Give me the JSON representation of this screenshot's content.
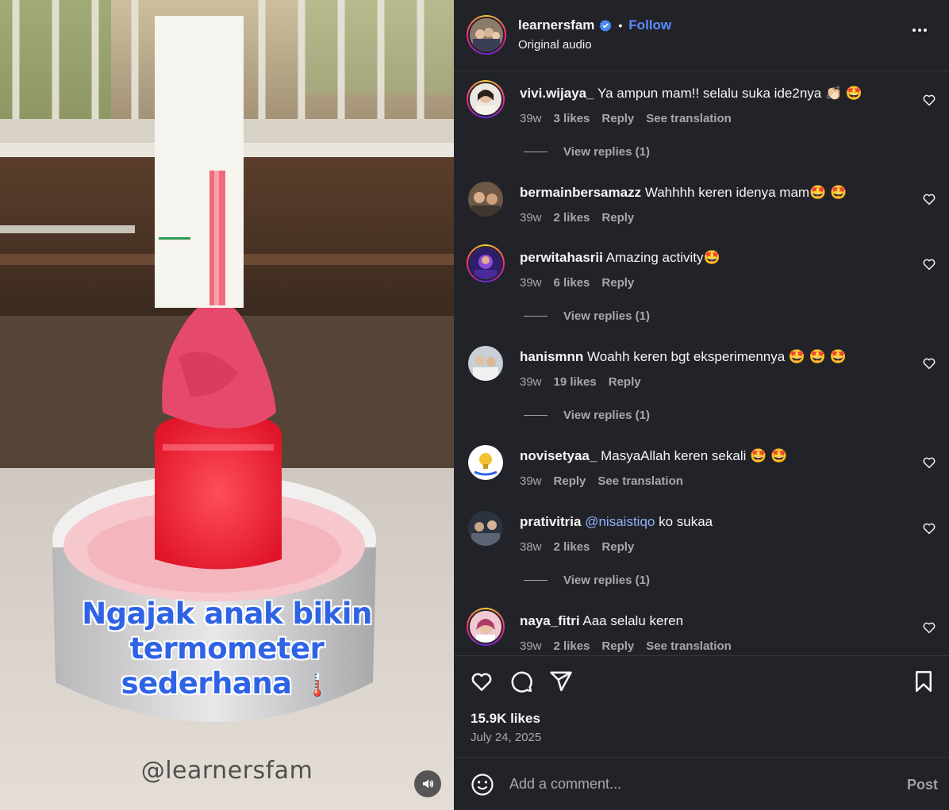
{
  "post": {
    "username": "learnersfam",
    "follow_label": "Follow",
    "audio": "Original audio",
    "video_overlay": {
      "title_lines": [
        "Ngajak anak bikin",
        "termometer",
        "sederhana"
      ],
      "emoji": "🌡️",
      "watermark": "@learnersfam"
    },
    "likes": "15.9K likes",
    "date": "July 24, 2025"
  },
  "comments": [
    {
      "user": "vivi.wijaya_",
      "text": "Ya ampun mam!! selalu suka ide2nya 👏🏻 🤩",
      "age": "39w",
      "likes": "3 likes",
      "reply": "Reply",
      "translation": "See translation",
      "replies": "View replies (1)"
    },
    {
      "user": "bermainbersamazz",
      "text": "Wahhhh keren idenya mam🤩 🤩",
      "age": "39w",
      "likes": "2 likes",
      "reply": "Reply"
    },
    {
      "user": "perwitahasrii",
      "text": "Amazing activity🤩",
      "age": "39w",
      "likes": "6 likes",
      "reply": "Reply",
      "replies": "View replies (1)"
    },
    {
      "user": "hanismnn",
      "text": "Woahh keren bgt eksperimennya 🤩 🤩 🤩",
      "age": "39w",
      "likes": "19 likes",
      "reply": "Reply",
      "replies": "View replies (1)"
    },
    {
      "user": "novisetyaa_",
      "text": "MasyaAllah keren sekali 🤩 🤩",
      "age": "39w",
      "reply": "Reply",
      "translation": "See translation"
    },
    {
      "user": "prativitria",
      "mention": "@nisaistiqo",
      "text": "ko sukaa",
      "age": "38w",
      "likes": "2 likes",
      "reply": "Reply",
      "replies": "View replies (1)"
    },
    {
      "user": "naya_fitri",
      "text": "Aaa selalu keren",
      "age": "39w",
      "likes": "2 likes",
      "reply": "Reply",
      "translation": "See translation"
    }
  ],
  "composer": {
    "placeholder": "Add a comment...",
    "post_label": "Post"
  },
  "colors": {
    "panel_bg": "#212328",
    "link_blue": "#5b8cff",
    "muted_text": "#a8a8a8",
    "overlay_text": "#2f63e6"
  },
  "icons": [
    "verified-badge-icon",
    "more-options-icon",
    "heart-icon",
    "comment-icon",
    "share-icon",
    "bookmark-icon",
    "emoji-icon",
    "volume-icon"
  ]
}
